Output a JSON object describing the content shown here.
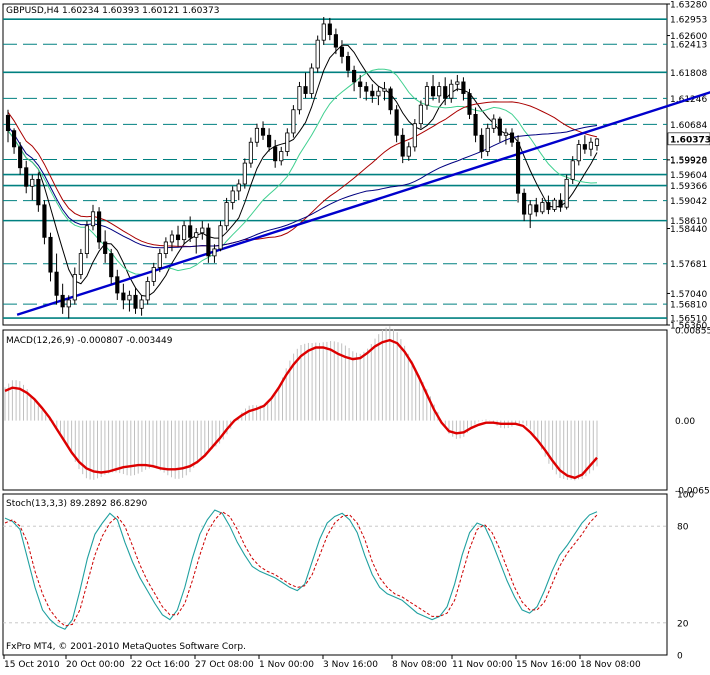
{
  "window": {
    "symbol_header": "GBPUSD,H4  1.60234 1.60393 1.60121 1.60373",
    "copyright": "FxPro MT4, © 2001-2010 MetaQuotes Software Corp."
  },
  "colors": {
    "background": "#ffffff",
    "frame": "#000000",
    "level_line": "#008080",
    "trendline": "#0000cc",
    "macd_signal": "#dd0000",
    "macd_hist": "#c0c0c0",
    "stoch_main": "#20a0a0",
    "stoch_signal": "#cc0000",
    "ma_fast": "#000000",
    "ma_mid": "#40d090",
    "ma_slow_red": "#aa0000",
    "ma_slow_blue": "#000080",
    "current_price_bg": "#ffffff"
  },
  "chart_data": [
    {
      "type": "candlestick",
      "name": "price",
      "ylim": [
        1.5636,
        1.6328
      ],
      "grid": false,
      "price_ticks": [
        "1.63280",
        "1.62600",
        "1.59920",
        "1.58440",
        "1.57040",
        "1.56360"
      ],
      "levels": [
        {
          "label": "1.62953",
          "value": 1.62953,
          "style": "solid"
        },
        {
          "label": "1.62413",
          "value": 1.62413,
          "style": "dashed"
        },
        {
          "label": "1.61808",
          "value": 1.61808,
          "style": "solid"
        },
        {
          "label": "1.61246",
          "value": 1.61246,
          "style": "dashed"
        },
        {
          "label": "1.60684",
          "value": 1.60684,
          "style": "dashed"
        },
        {
          "label": "1.59928",
          "value": 1.59928,
          "style": "dashed"
        },
        {
          "label": "1.59604",
          "value": 1.59604,
          "style": "solid"
        },
        {
          "label": "1.59366",
          "value": 1.59366,
          "style": "solid"
        },
        {
          "label": "1.59042",
          "value": 1.59042,
          "style": "dashed"
        },
        {
          "label": "1.58610",
          "value": 1.5861,
          "style": "solid"
        },
        {
          "label": "1.57681",
          "value": 1.57681,
          "style": "dashed"
        },
        {
          "label": "1.56810",
          "value": 1.5681,
          "style": "dashed"
        },
        {
          "label": "1.56510",
          "value": 1.5651,
          "style": "solid"
        }
      ],
      "current_price": {
        "label": "1.60373",
        "value": 1.60373
      },
      "trendline": {
        "from": [
          3,
          1.5658
        ],
        "to": [
          175,
          1.617
        ]
      },
      "candles": [
        [
          1.6088,
          1.61,
          1.603,
          1.6055
        ],
        [
          1.6055,
          1.606,
          1.6005,
          1.602
        ],
        [
          1.602,
          1.603,
          1.596,
          1.5975
        ],
        [
          1.5975,
          1.599,
          1.592,
          1.5935
        ],
        [
          1.5935,
          1.596,
          1.5905,
          1.595
        ],
        [
          1.595,
          1.5965,
          1.588,
          1.5895
        ],
        [
          1.5895,
          1.5905,
          1.581,
          1.5825
        ],
        [
          1.5825,
          1.5835,
          1.573,
          1.575
        ],
        [
          1.575,
          1.579,
          1.568,
          1.57
        ],
        [
          1.57,
          1.5725,
          1.566,
          1.5675
        ],
        [
          1.5675,
          1.57,
          1.565,
          1.569
        ],
        [
          1.569,
          1.576,
          1.568,
          1.5745
        ],
        [
          1.5745,
          1.58,
          1.5735,
          1.579
        ],
        [
          1.579,
          1.586,
          1.578,
          1.585
        ],
        [
          1.585,
          1.5895,
          1.584,
          1.588
        ],
        [
          1.588,
          1.589,
          1.58,
          1.5815
        ],
        [
          1.5815,
          1.584,
          1.577,
          1.579
        ],
        [
          1.579,
          1.58,
          1.5725,
          1.574
        ],
        [
          1.574,
          1.5755,
          1.569,
          1.5705
        ],
        [
          1.5705,
          1.5725,
          1.567,
          1.569
        ],
        [
          1.569,
          1.571,
          1.5665,
          1.57
        ],
        [
          1.57,
          1.5715,
          1.566,
          1.5672
        ],
        [
          1.5672,
          1.57,
          1.5656,
          1.569
        ],
        [
          1.569,
          1.574,
          1.568,
          1.573
        ],
        [
          1.573,
          1.577,
          1.572,
          1.576
        ],
        [
          1.576,
          1.58,
          1.575,
          1.579
        ],
        [
          1.579,
          1.5825,
          1.578,
          1.5815
        ],
        [
          1.5815,
          1.584,
          1.5795,
          1.583
        ],
        [
          1.583,
          1.585,
          1.5805,
          1.582
        ],
        [
          1.582,
          1.586,
          1.581,
          1.585
        ],
        [
          1.585,
          1.587,
          1.5815,
          1.5825
        ],
        [
          1.5825,
          1.5845,
          1.579,
          1.5835
        ],
        [
          1.5835,
          1.586,
          1.582,
          1.5845
        ],
        [
          1.5845,
          1.5855,
          1.577,
          1.5785
        ],
        [
          1.5785,
          1.581,
          1.577,
          1.58
        ],
        [
          1.58,
          1.586,
          1.5795,
          1.585
        ],
        [
          1.585,
          1.591,
          1.584,
          1.59
        ],
        [
          1.59,
          1.5935,
          1.5885,
          1.5925
        ],
        [
          1.5925,
          1.595,
          1.5905,
          1.594
        ],
        [
          1.594,
          1.5995,
          1.593,
          1.5985
        ],
        [
          1.5985,
          1.604,
          1.5975,
          1.603
        ],
        [
          1.603,
          1.607,
          1.602,
          1.606
        ],
        [
          1.606,
          1.6075,
          1.6035,
          1.6045
        ],
        [
          1.6045,
          1.606,
          1.601,
          1.602
        ],
        [
          1.602,
          1.6035,
          1.5975,
          1.599
        ],
        [
          1.599,
          1.602,
          1.598,
          1.601
        ],
        [
          1.601,
          1.606,
          1.6,
          1.605
        ],
        [
          1.605,
          1.611,
          1.604,
          1.61
        ],
        [
          1.61,
          1.616,
          1.609,
          1.615
        ],
        [
          1.615,
          1.618,
          1.6125,
          1.6135
        ],
        [
          1.6135,
          1.62,
          1.6125,
          1.619
        ],
        [
          1.619,
          1.626,
          1.618,
          1.625
        ],
        [
          1.625,
          1.63,
          1.624,
          1.6285
        ],
        [
          1.6285,
          1.6298,
          1.625,
          1.6262
        ],
        [
          1.6262,
          1.6275,
          1.622,
          1.6235
        ],
        [
          1.6235,
          1.625,
          1.62,
          1.6215
        ],
        [
          1.6215,
          1.6225,
          1.617,
          1.6185
        ],
        [
          1.6185,
          1.6195,
          1.614,
          1.616
        ],
        [
          1.616,
          1.6175,
          1.6125,
          1.615
        ],
        [
          1.615,
          1.616,
          1.612,
          1.614
        ],
        [
          1.614,
          1.6155,
          1.6115,
          1.613
        ],
        [
          1.613,
          1.615,
          1.611,
          1.614
        ],
        [
          1.614,
          1.616,
          1.612,
          1.6145
        ],
        [
          1.6145,
          1.615,
          1.609,
          1.61
        ],
        [
          1.61,
          1.611,
          1.603,
          1.6045
        ],
        [
          1.6045,
          1.606,
          1.5985,
          1.6
        ],
        [
          1.6,
          1.603,
          1.599,
          1.602
        ],
        [
          1.602,
          1.608,
          1.601,
          1.607
        ],
        [
          1.607,
          1.612,
          1.606,
          1.611
        ],
        [
          1.611,
          1.616,
          1.61,
          1.615
        ],
        [
          1.615,
          1.6175,
          1.612,
          1.613
        ],
        [
          1.613,
          1.616,
          1.6115,
          1.615
        ],
        [
          1.615,
          1.617,
          1.611,
          1.6125
        ],
        [
          1.6125,
          1.6165,
          1.6115,
          1.6155
        ],
        [
          1.6155,
          1.6175,
          1.614,
          1.616
        ],
        [
          1.616,
          1.617,
          1.612,
          1.6135
        ],
        [
          1.6135,
          1.6145,
          1.608,
          1.609
        ],
        [
          1.609,
          1.6105,
          1.603,
          1.6045
        ],
        [
          1.6045,
          1.606,
          1.5995,
          1.601
        ],
        [
          1.601,
          1.607,
          1.6,
          1.606
        ],
        [
          1.606,
          1.609,
          1.605,
          1.608
        ],
        [
          1.608,
          1.6085,
          1.603,
          1.6045
        ],
        [
          1.6045,
          1.606,
          1.6025,
          1.605
        ],
        [
          1.605,
          1.606,
          1.602,
          1.603
        ],
        [
          1.603,
          1.6045,
          1.59,
          1.592
        ],
        [
          1.592,
          1.593,
          1.586,
          1.5875
        ],
        [
          1.5875,
          1.5905,
          1.5845,
          1.5895
        ],
        [
          1.5895,
          1.591,
          1.587,
          1.588
        ],
        [
          1.588,
          1.591,
          1.5875,
          1.59
        ],
        [
          1.59,
          1.5915,
          1.5875,
          1.5885
        ],
        [
          1.5885,
          1.591,
          1.588,
          1.5905
        ],
        [
          1.5905,
          1.592,
          1.588,
          1.589
        ],
        [
          1.589,
          1.596,
          1.5885,
          1.595
        ],
        [
          1.595,
          1.6,
          1.594,
          1.599
        ],
        [
          1.599,
          1.6035,
          1.598,
          1.6025
        ],
        [
          1.6025,
          1.6045,
          1.6005,
          1.6015
        ],
        [
          1.6015,
          1.604,
          1.6,
          1.603
        ],
        [
          1.6023,
          1.6039,
          1.6012,
          1.6037
        ]
      ]
    },
    {
      "type": "line",
      "name": "macd",
      "label": "MACD(12,26,9) -0.000807 -0.003449",
      "ylim": [
        -0.00655,
        0.00855
      ],
      "ticks": [
        "0.00855",
        "0.00",
        "-0.00655"
      ],
      "signal": [
        0.0028,
        0.0031,
        0.003,
        0.0026,
        0.002,
        0.0012,
        0.0003,
        -0.0008,
        -0.0019,
        -0.003,
        -0.0039,
        -0.0045,
        -0.0048,
        -0.0049,
        -0.0048,
        -0.0046,
        -0.0044,
        -0.0043,
        -0.0042,
        -0.0042,
        -0.0043,
        -0.0045,
        -0.0046,
        -0.0046,
        -0.0045,
        -0.0043,
        -0.0039,
        -0.0033,
        -0.0025,
        -0.0017,
        -0.0008,
        0.0,
        0.0005,
        0.0009,
        0.0011,
        0.0014,
        0.0021,
        0.0031,
        0.0043,
        0.0053,
        0.0061,
        0.0066,
        0.0069,
        0.0069,
        0.0067,
        0.0063,
        0.006,
        0.0058,
        0.0059,
        0.0064,
        0.007,
        0.0074,
        0.0076,
        0.0073,
        0.0065,
        0.0054,
        0.004,
        0.0025,
        0.001,
        -0.0002,
        -0.001,
        -0.0012,
        -0.0011,
        -0.0007,
        -0.0004,
        -0.0002,
        -0.0002,
        -0.0003,
        -0.0003,
        -0.0003,
        -0.0005,
        -0.0011,
        -0.0019,
        -0.0028,
        -0.0038,
        -0.0047,
        -0.0052,
        -0.0054,
        -0.0051,
        -0.0043,
        -0.0035
      ]
    },
    {
      "type": "line",
      "name": "stochastic",
      "label": "Stoch(13,3,3) 89.2892 86.8290",
      "ylim": [
        0,
        100
      ],
      "ticks": [
        "100",
        "80",
        "20",
        "0"
      ],
      "main": [
        85,
        83,
        78,
        60,
        42,
        28,
        22,
        18,
        16,
        22,
        40,
        60,
        75,
        82,
        88,
        84,
        70,
        58,
        48,
        40,
        32,
        25,
        22,
        28,
        42,
        60,
        75,
        84,
        90,
        88,
        80,
        70,
        62,
        55,
        52,
        50,
        48,
        45,
        42,
        40,
        44,
        58,
        72,
        82,
        86,
        88,
        84,
        76,
        62,
        50,
        42,
        38,
        36,
        34,
        30,
        26,
        24,
        22,
        24,
        30,
        44,
        62,
        76,
        82,
        80,
        70,
        58,
        46,
        36,
        28,
        26,
        30,
        40,
        52,
        62,
        68,
        75,
        82,
        87,
        89
      ],
      "signal": [
        82,
        84,
        80,
        70,
        52,
        38,
        28,
        22,
        18,
        19,
        28,
        45,
        62,
        74,
        82,
        86,
        80,
        68,
        56,
        46,
        38,
        30,
        25,
        25,
        32,
        46,
        62,
        76,
        84,
        89,
        86,
        78,
        68,
        60,
        55,
        52,
        50,
        47,
        44,
        42,
        43,
        50,
        62,
        74,
        82,
        86,
        87,
        82,
        72,
        58,
        48,
        42,
        38,
        36,
        33,
        30,
        27,
        24,
        24,
        26,
        34,
        50,
        66,
        78,
        81,
        76,
        66,
        54,
        42,
        33,
        28,
        28,
        33,
        44,
        55,
        63,
        69,
        75,
        82,
        87
      ]
    }
  ],
  "time_axis": {
    "labels": [
      "15 Oct 2010",
      "20 Oct 00:00",
      "22 Oct 16:00",
      "27 Oct 08:00",
      "1 Nov 00:00",
      "3 Nov 16:00",
      "8 Nov 08:00",
      "11 Nov 00:00",
      "15 Nov 16:00",
      "18 Nov 08:00"
    ]
  }
}
